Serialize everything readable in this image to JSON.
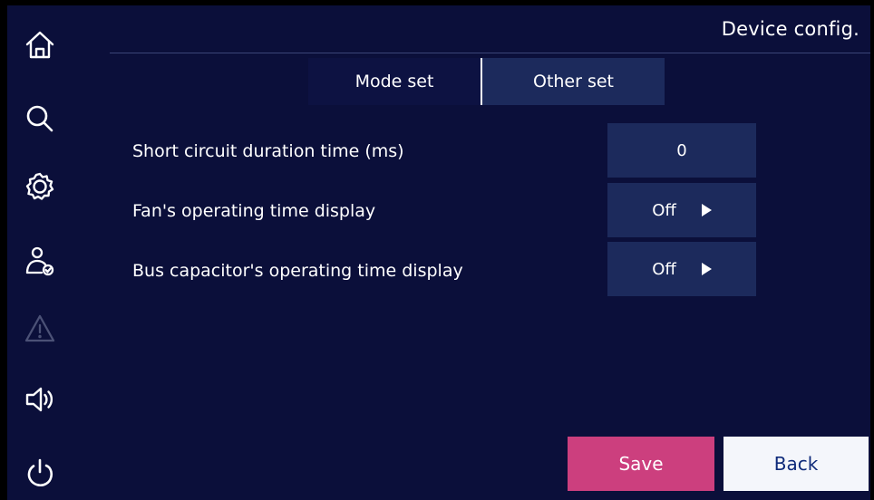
{
  "header": {
    "title": "Device config."
  },
  "sidebar": {
    "items": [
      {
        "icon": "home-icon"
      },
      {
        "icon": "search-icon"
      },
      {
        "icon": "gear-icon"
      },
      {
        "icon": "user-check-icon"
      },
      {
        "icon": "warning-icon",
        "disabled": true
      },
      {
        "icon": "speaker-icon"
      },
      {
        "icon": "power-icon"
      }
    ]
  },
  "tabs": [
    {
      "label": "Mode set",
      "active": false
    },
    {
      "label": "Other set",
      "active": true
    }
  ],
  "settings": [
    {
      "label": "Short circuit duration time (ms)",
      "value": "0",
      "type": "numeric"
    },
    {
      "label": "Fan's operating time display",
      "value": "Off",
      "type": "dropdown"
    },
    {
      "label": "Bus capacitor's operating time display",
      "value": "Off",
      "type": "dropdown"
    }
  ],
  "buttons": {
    "save": "Save",
    "back": "Back"
  },
  "colors": {
    "background": "#0b0f3a",
    "panel": "#1c2a5c",
    "save": "#cc3f7e",
    "back": "#f4f6fb",
    "back_text": "#0e2a7a",
    "disabled_icon": "#4b5176"
  }
}
